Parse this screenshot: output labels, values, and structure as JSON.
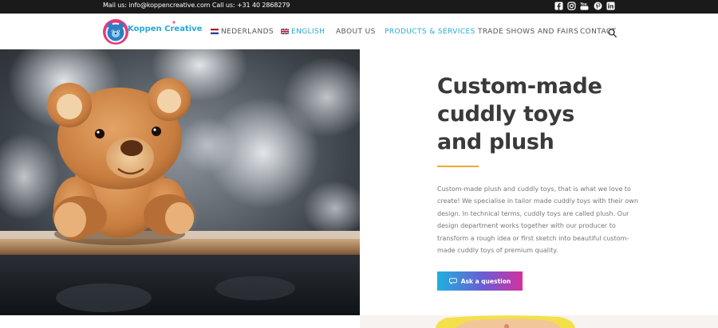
{
  "topbar": {
    "contact_text": "Mail us: info@koppencreative.com Call us: +31 40 2868279",
    "social_icons": [
      "facebook-icon",
      "instagram-icon",
      "youtube-icon",
      "pinterest-icon",
      "linkedin-icon"
    ]
  },
  "brand": {
    "name": "Koppen Creative",
    "accent": "#26a9d4",
    "logo_pink": "#e4397a"
  },
  "nav": {
    "items": [
      {
        "label": "NEDERLANDS",
        "active": false
      },
      {
        "label": "ENGLISH",
        "active": true
      },
      {
        "label": "ABOUT US",
        "active": false
      },
      {
        "label": "PRODUCTS & SERVICES",
        "active": true
      },
      {
        "label": "TRADE SHOWS AND FAIRS",
        "active": false
      },
      {
        "label": "CONTACT",
        "active": false
      }
    ],
    "search_icon": "search-icon"
  },
  "hero": {
    "image_alt": "teddy bear on a wooden shelf",
    "title": "Custom-made cuddly toys and plush",
    "description": "Custom-made plush and cuddly toys, that is what we love to create! We specialise in tailor made cuddly toys with their own design. In technical terms, cuddly toys are called plush. Our design department works together with our producer to transform a rough idea or first sketch into beautiful custom-made cuddly toys of premium quality.",
    "cta_label": "Ask a question",
    "divider_color": "#f0a92d"
  }
}
